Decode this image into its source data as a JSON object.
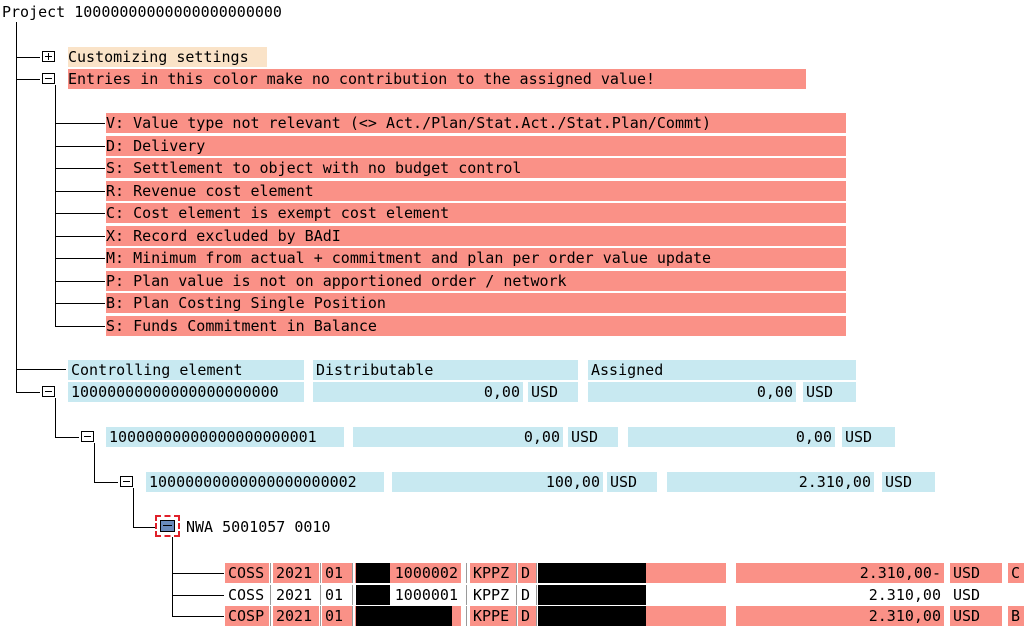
{
  "project_title": "Project 10000000000000000000000",
  "customizing_label": "Customizing settings",
  "legend_header": "Entries in this color make no contribution to the assigned value!",
  "legend_items": [
    "V: Value type not relevant (<> Act./Plan/Stat.Act./Stat.Plan/Commt)",
    "D: Delivery",
    "S: Settlement to object with no budget control",
    "R: Revenue cost element",
    "C: Cost element is exempt cost element",
    "X: Record excluded by BAdI",
    "M: Minimum from actual + commitment and plan per order value update",
    "P: Plan value is not on apportioned order / network",
    "B: Plan Costing Single Position",
    "S: Funds Commitment in Balance"
  ],
  "columns": {
    "controlling_element": "Controlling element",
    "distributable": "Distributable",
    "assigned": "Assigned"
  },
  "hierarchy": [
    {
      "element": "10000000000000000000000",
      "distributable": "0,00",
      "dist_currency": "USD",
      "assigned": "0,00",
      "assigned_currency": "USD"
    },
    {
      "element": "10000000000000000000001",
      "distributable": "0,00",
      "dist_currency": "USD",
      "assigned": "0,00",
      "assigned_currency": "USD"
    },
    {
      "element": "10000000000000000000002",
      "distributable": "100,00",
      "dist_currency": "USD",
      "assigned": "2.310,00",
      "assigned_currency": "USD"
    }
  ],
  "network_activity": "NWA 5001057 0010",
  "line_items": [
    {
      "table": "COSS",
      "year": "2021",
      "period": "01",
      "doc": "1000002",
      "ce": "KPPZ",
      "flag": "D",
      "value": "2.310,00-",
      "currency": "USD",
      "code": "C",
      "highlight": true
    },
    {
      "table": "COSS",
      "year": "2021",
      "period": "01",
      "doc": "1000001",
      "ce": "KPPZ",
      "flag": "D",
      "value": "2.310,00",
      "currency": "USD",
      "code": "",
      "highlight": false
    },
    {
      "table": "COSP",
      "year": "2021",
      "period": "01",
      "doc": "",
      "ce": "KPPE",
      "flag": "D",
      "value": "2.310,00",
      "currency": "USD",
      "code": "B",
      "highlight": true
    }
  ],
  "colors": {
    "excluded_row": "#fa9187",
    "cyan_field": "#c8e9f1",
    "customizing_bg": "#fae3c8",
    "selection_border": "#e0202a"
  }
}
